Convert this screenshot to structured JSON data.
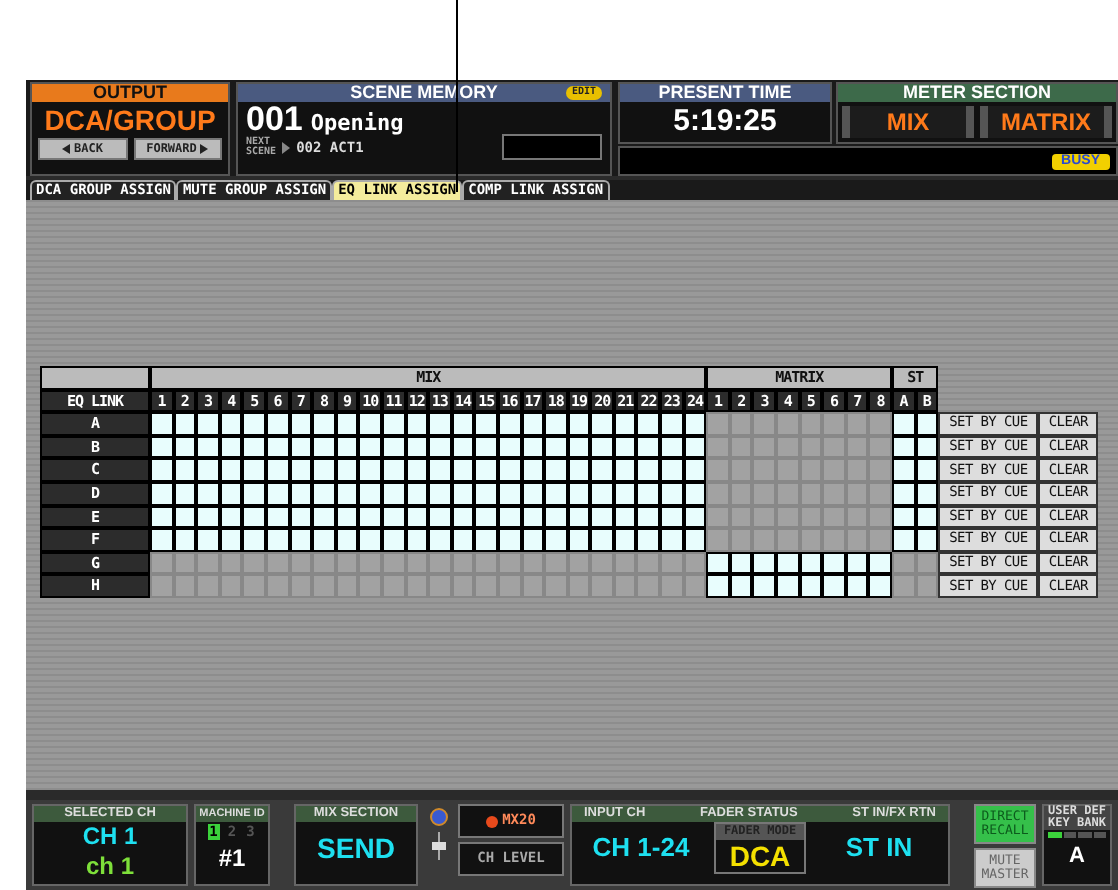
{
  "output": {
    "title": "OUTPUT",
    "value": "DCA/GROUP",
    "buttons": [
      {
        "label": "BACK",
        "kind": "back"
      },
      {
        "label": "FORWARD",
        "kind": "forward"
      }
    ]
  },
  "scene_memory": {
    "title": "SCENE MEMORY",
    "badge": "EDIT",
    "number": "001",
    "name": "Opening",
    "next_label": [
      "NEXT",
      "SCENE"
    ],
    "next": "002 ACT1"
  },
  "present_time": {
    "title": "PRESENT TIME",
    "value": "5:19:25"
  },
  "meter_section": {
    "title": "METER SECTION",
    "buttons": [
      "MIX",
      "MATRIX"
    ]
  },
  "status": {
    "busy": "BUSY"
  },
  "tabs": [
    {
      "label": "DCA GROUP ASSIGN",
      "selected": false
    },
    {
      "label": "MUTE GROUP ASSIGN",
      "selected": false
    },
    {
      "label": "EQ LINK ASSIGN",
      "selected": true
    },
    {
      "label": "COMP LINK ASSIGN",
      "selected": false
    }
  ],
  "eq_link": {
    "corner": "EQ LINK",
    "groups": [
      {
        "label": "MIX",
        "columns": [
          "1",
          "2",
          "3",
          "4",
          "5",
          "6",
          "7",
          "8",
          "9",
          "10",
          "11",
          "12",
          "13",
          "14",
          "15",
          "16",
          "17",
          "18",
          "19",
          "20",
          "21",
          "22",
          "23",
          "24"
        ]
      },
      {
        "label": "MATRIX",
        "columns": [
          "1",
          "2",
          "3",
          "4",
          "5",
          "6",
          "7",
          "8"
        ]
      },
      {
        "label": "ST",
        "columns": [
          "A",
          "B"
        ]
      }
    ],
    "rows": [
      {
        "label": "A",
        "enabled": [
          true,
          false,
          true
        ],
        "buttons": [
          "SET BY CUE",
          "CLEAR"
        ]
      },
      {
        "label": "B",
        "enabled": [
          true,
          false,
          true
        ],
        "buttons": [
          "SET BY CUE",
          "CLEAR"
        ]
      },
      {
        "label": "C",
        "enabled": [
          true,
          false,
          true
        ],
        "buttons": [
          "SET BY CUE",
          "CLEAR"
        ]
      },
      {
        "label": "D",
        "enabled": [
          true,
          false,
          true
        ],
        "buttons": [
          "SET BY CUE",
          "CLEAR"
        ]
      },
      {
        "label": "E",
        "enabled": [
          true,
          false,
          true
        ],
        "buttons": [
          "SET BY CUE",
          "CLEAR"
        ]
      },
      {
        "label": "F",
        "enabled": [
          true,
          false,
          true
        ],
        "buttons": [
          "SET BY CUE",
          "CLEAR"
        ]
      },
      {
        "label": "G",
        "enabled": [
          false,
          true,
          false
        ],
        "buttons": [
          "SET BY CUE",
          "CLEAR"
        ]
      },
      {
        "label": "H",
        "enabled": [
          false,
          true,
          false
        ],
        "buttons": [
          "SET BY CUE",
          "CLEAR"
        ]
      }
    ]
  },
  "selected_ch": {
    "title": "SELECTED CH",
    "channel": "CH 1",
    "name": "ch 1"
  },
  "machine_id": {
    "title": "MACHINE ID",
    "ids": [
      {
        "label": "1",
        "selected": true
      },
      {
        "label": "2",
        "selected": false
      },
      {
        "label": "3",
        "selected": false
      }
    ],
    "value": "#1"
  },
  "mix_section": {
    "title": "MIX SECTION",
    "value": "SEND",
    "target": "MX20",
    "mode": "CH LEVEL"
  },
  "fader_status": {
    "title": "FADER STATUS",
    "input_label": "INPUT CH",
    "input_value": "CH 1-24",
    "mode_label": "FADER MODE",
    "mode_value": "DCA",
    "stin_label": "ST IN/FX RTN",
    "stin_value": "ST IN"
  },
  "keys": [
    {
      "label": "DIRECT RECALL",
      "on": true
    },
    {
      "label": "MUTE MASTER",
      "on": false
    }
  ],
  "user_def": {
    "title": "USER DEF KEY BANK",
    "segments": [
      {
        "selected": true
      },
      {
        "selected": false
      },
      {
        "selected": false
      },
      {
        "selected": false
      }
    ],
    "value": "A"
  }
}
